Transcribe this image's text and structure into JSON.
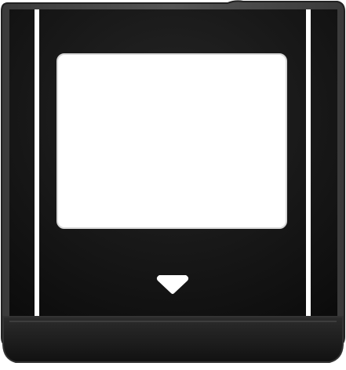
{
  "cartridge": {
    "shell_color": "#4a4a4a",
    "shell_highlight": "#6a6a6a",
    "label_panel_color": "#111111",
    "label_area_color": "#ffffff",
    "stripe_color": "#ffffff",
    "grip_color": "#1a1a1a",
    "arrow_color": "#ffffff",
    "arrow_icon": "triangle-down-icon"
  }
}
